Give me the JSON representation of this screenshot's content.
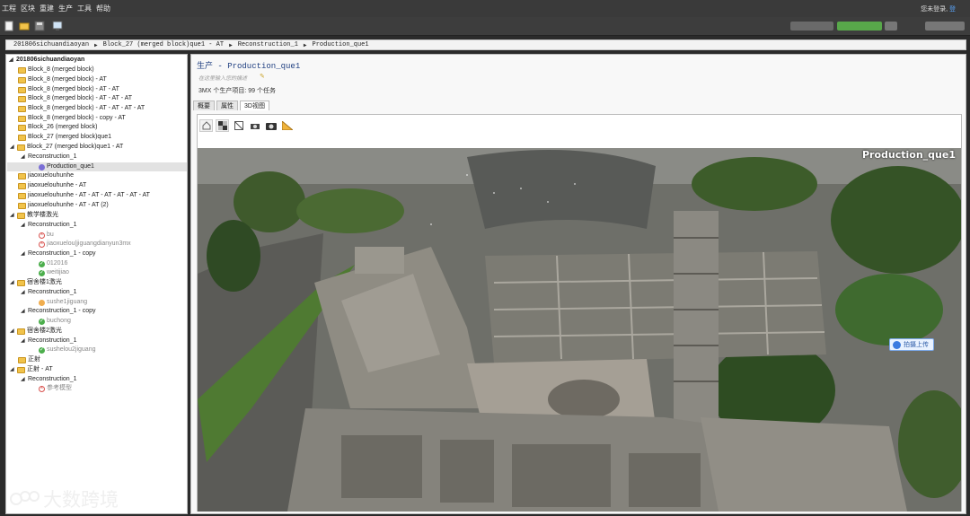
{
  "menu": [
    "工程",
    "区块",
    "重建",
    "生产",
    "工具",
    "帮助"
  ],
  "login": {
    "text": "您未登录",
    "link": "登"
  },
  "breadcrumb": [
    "201806sichuandiaoyan",
    "Block_27 (merged block)que1 - AT",
    "Reconstruction_1",
    "Production_que1"
  ],
  "tree": {
    "root": "201806sichuandiaoyan",
    "items": [
      "Block_8 (merged block)",
      "Block_8 (merged block) - AT",
      "Block_8 (merged block) - AT - AT",
      "Block_8 (merged block) - AT - AT - AT",
      "Block_8 (merged block) - AT - AT - AT - AT",
      "Block_8 (merged block) - copy - AT",
      "Block_26 (merged block)",
      "Block_27 (merged block)que1",
      "Block_27 (merged block)que1 - AT",
      "Reconstruction_1",
      "Production_que1",
      "jiaoxuelouhunhe",
      "jiaoxuelouhunhe - AT",
      "jiaoxuelouhunhe - AT - AT - AT - AT - AT - AT",
      "jiaoxuelouhunhe - AT - AT (2)",
      "教学楼激光",
      "Reconstruction_1",
      "bu",
      "jiaoxuelou|jiguangdianyun3mx",
      "Reconstruction_1 - copy",
      "012016",
      "weitijiao",
      "宿舍楼1激光",
      "Reconstruction_1",
      "sushe1jiguang",
      "Reconstruction_1 - copy",
      "buchong",
      "宿舍楼2激光",
      "Reconstruction_1",
      "sushelou2jiguang",
      "正射",
      "正射 - AT",
      "Reconstruction_1",
      "参考模型"
    ]
  },
  "production": {
    "title": "生产 - Production_que1",
    "description": "在这里输入您的描述",
    "summary": "3MX 个生产项目: 99 个任务"
  },
  "tabs": [
    "概要",
    "属性",
    "3D视图"
  ],
  "view": {
    "overlay_name": "Production_que1",
    "share_label": "拍摄上传"
  },
  "watermark": "大数跨境",
  "colors": {
    "folder": "#f1c34b",
    "ok": "#4cae4c",
    "error": "#d9534f",
    "title": "#1f3f80"
  }
}
